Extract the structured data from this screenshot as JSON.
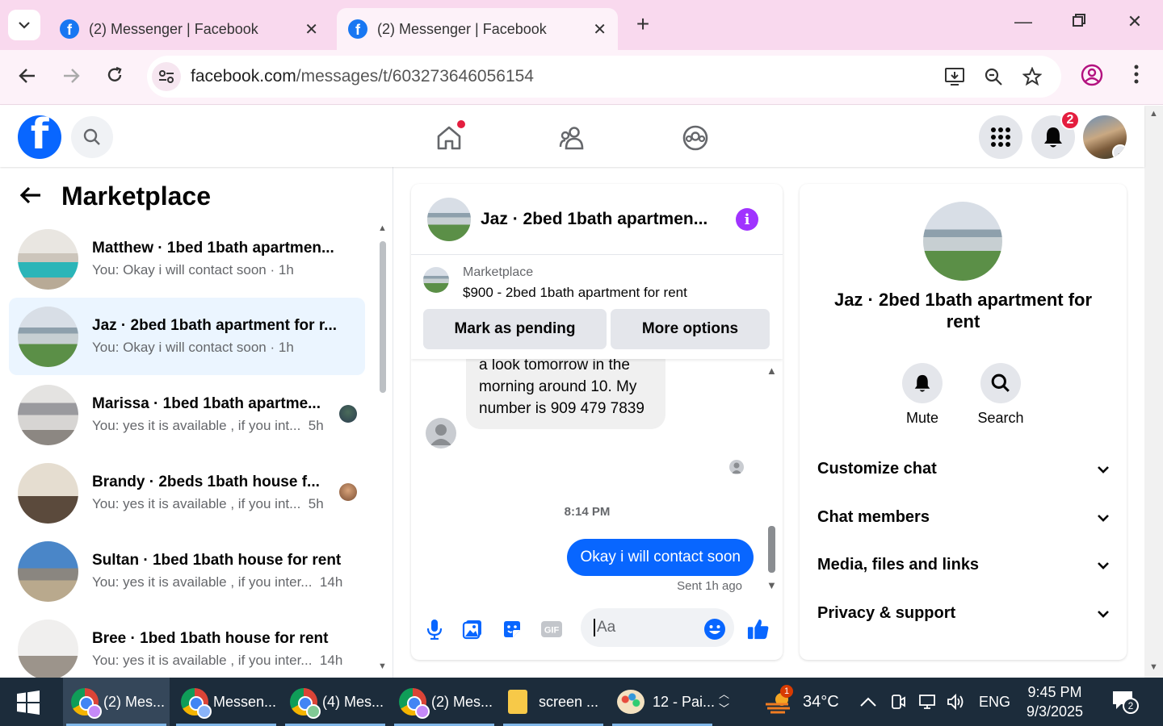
{
  "browser": {
    "tabs": [
      {
        "title": "(2) Messenger | Facebook",
        "active": false
      },
      {
        "title": "(2) Messenger | Facebook",
        "active": true
      }
    ],
    "url_host": "facebook.com",
    "url_path": "/messages/t/603273646056154"
  },
  "fb_header": {
    "notification_count": "2"
  },
  "left": {
    "title": "Marketplace",
    "conversations": [
      {
        "name": "Matthew · 1bed 1bath apartmen...",
        "preview": "You: Okay i will contact soon · 1h"
      },
      {
        "name": "Jaz · 2bed 1bath apartment for r...",
        "preview": "You: Okay i will contact soon · 1h"
      },
      {
        "name": "Marissa · 1bed 1bath apartme...",
        "preview": "You: yes it is available , if you int...",
        "time": "5h"
      },
      {
        "name": "Brandy · 2beds 1bath house f...",
        "preview": "You: yes it is available , if you int...",
        "time": "5h"
      },
      {
        "name": "Sultan · 1bed 1bath house for rent",
        "preview": "You: yes it is available , if you inter...",
        "time": "14h"
      },
      {
        "name": "Bree · 1bed 1bath house for rent",
        "preview": "You: yes it is available , if you inter...",
        "time": "14h"
      }
    ]
  },
  "chat": {
    "title": "Jaz · 2bed 1bath apartmen...",
    "listing_category": "Marketplace",
    "listing_title": "$900 - 2bed 1bath apartment for rent",
    "btn_pending": "Mark as pending",
    "btn_more": "More options",
    "incoming_text": "a look tomorrow in the morning around 10. My number is 909 479 7839",
    "timestamp": "8:14 PM",
    "outgoing_text": "Okay i will contact soon",
    "sent_status": "Sent 1h ago",
    "input_placeholder": "Aa"
  },
  "info": {
    "name": "Jaz · 2bed 1bath apartment for rent",
    "mute_label": "Mute",
    "search_label": "Search",
    "sections": [
      "Customize chat",
      "Chat members",
      "Media, files and links",
      "Privacy & support"
    ]
  },
  "taskbar": {
    "items": [
      "(2) Mes...",
      "Messen...",
      "(4) Mes...",
      "(2) Mes...",
      "screen ...",
      "12 - Pai..."
    ],
    "weather": "34°C",
    "weather_badge": "1",
    "lang": "ENG",
    "time": "9:45 PM",
    "date": "9/3/2025",
    "notif_count": "2"
  }
}
